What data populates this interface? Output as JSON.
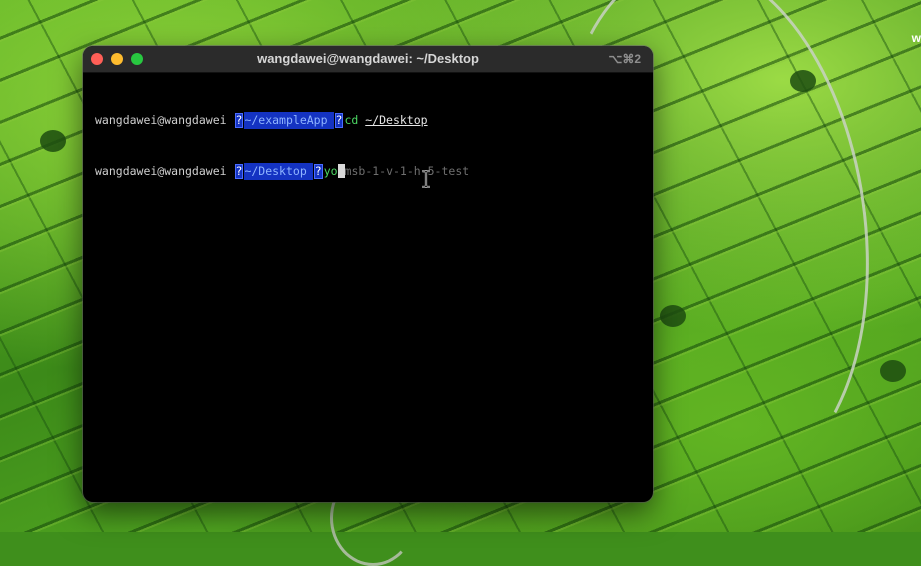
{
  "window": {
    "title": "wangdawei@wangdawei: ~/Desktop",
    "shortcut": "⌥⌘2"
  },
  "terminal": {
    "lines": [
      {
        "user": "wangdawei@wangdawei",
        "symbol": "?",
        "path": "~/exampleApp",
        "symbol2": "?",
        "command": "cd",
        "argument": "~/Desktop"
      },
      {
        "user": "wangdawei@wangdawei",
        "symbol": "?",
        "path": "~/Desktop",
        "symbol2": "?",
        "typed": "yo",
        "suggestion": "msb-1-v-1-h-5-test"
      }
    ]
  },
  "desktop": {
    "edge_text": "w"
  },
  "colors": {
    "terminal_bg": "#000000",
    "titlebar_bg": "#2b2b2b",
    "prompt_segment": "#1433c2",
    "command_green": "#4cd964",
    "suggestion_gray": "#6e6e6e",
    "close": "#ff5f57",
    "minimize": "#febc2e",
    "maximize": "#28c840"
  },
  "icons": [
    "close-icon",
    "minimize-icon",
    "maximize-icon",
    "text-cursor-icon"
  ]
}
